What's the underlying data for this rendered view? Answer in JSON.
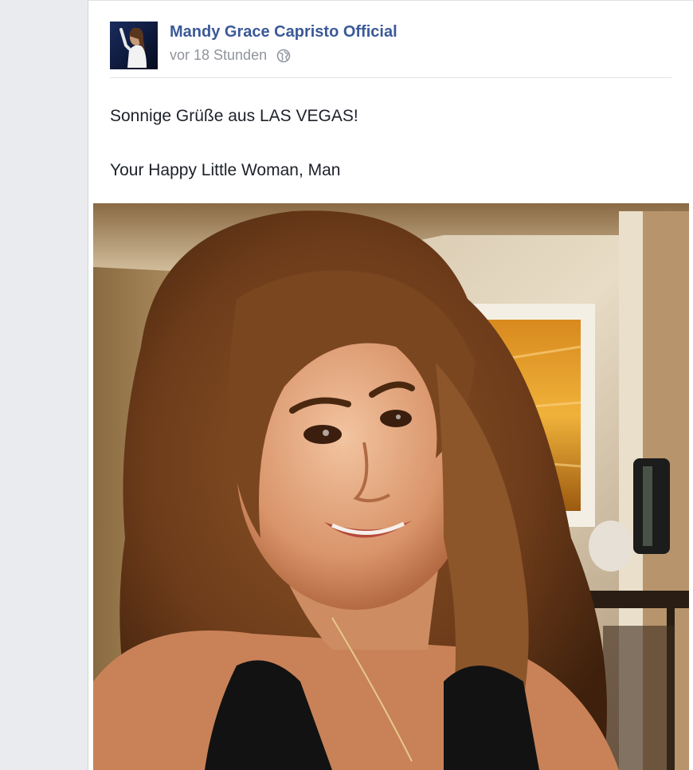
{
  "post": {
    "author": "Mandy Grace Capristo Official",
    "timestamp": "vor 18 Stunden",
    "audience_icon": "globe-icon",
    "text_line_1": "Sonnige Grüße aus LAS VEGAS!",
    "text_line_2": "Your Happy Little Woman, Man",
    "link_color": "#3b5998",
    "meta_color": "#90949c"
  }
}
